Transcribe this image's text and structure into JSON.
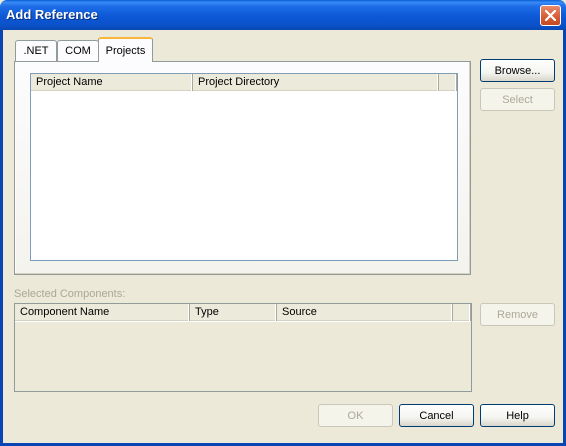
{
  "window": {
    "title": "Add Reference"
  },
  "tabs": [
    {
      "label": ".NET",
      "active": false
    },
    {
      "label": "COM",
      "active": false
    },
    {
      "label": "Projects",
      "active": true
    }
  ],
  "projects_list": {
    "columns": [
      "Project Name",
      "Project Directory"
    ]
  },
  "side_buttons": {
    "browse": "Browse...",
    "select": "Select",
    "remove": "Remove"
  },
  "selected_components": {
    "label": "Selected Components:",
    "columns": [
      "Component Name",
      "Type",
      "Source"
    ]
  },
  "footer_buttons": {
    "ok": "OK",
    "cancel": "Cancel",
    "help": "Help"
  },
  "colors": {
    "titlebar": "#0b52c9",
    "dialog_bg": "#ece9d8",
    "close_button": "#d65a34",
    "disabled_text": "#aca899"
  }
}
